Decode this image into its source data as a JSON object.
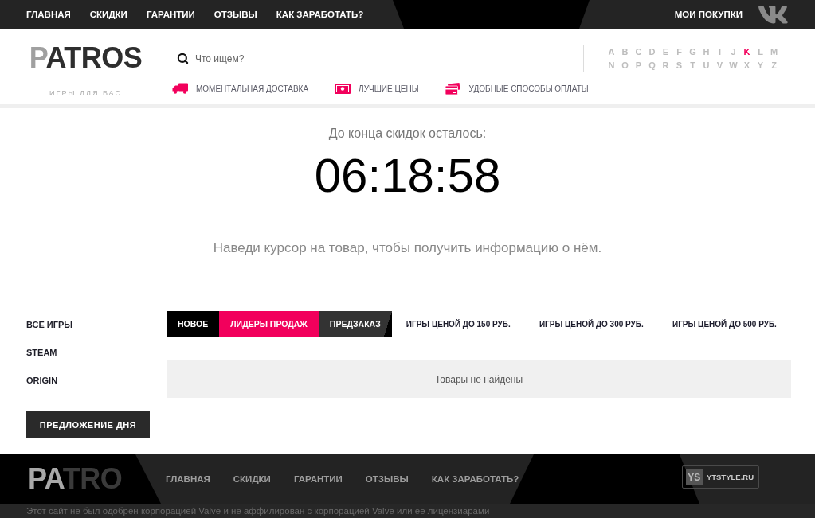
{
  "top_nav": {
    "links": [
      "ГЛАВНАЯ",
      "СКИДКИ",
      "ГАРАНТИИ",
      "ОТЗЫВЫ",
      "КАК ЗАРАБОТАТЬ?"
    ],
    "purchases": "МОИ ПОКУПКИ"
  },
  "header": {
    "logo": {
      "accent": "P",
      "rest": "ATROS"
    },
    "tagline": "ИГРЫ ДЛЯ ВАС",
    "search": {
      "placeholder": "Что ищем?"
    },
    "features": [
      {
        "kind": "delivery",
        "label": "МОМЕНТАЛЬНАЯ ДОСТАВКА"
      },
      {
        "kind": "price",
        "label": "ЛУЧШИЕ ЦЕНЫ"
      },
      {
        "kind": "payment",
        "label": "УДОБНЫЕ СПОСОБЫ ОПЛАТЫ"
      }
    ],
    "alphabet": [
      {
        "letter": "A",
        "selected": false
      },
      {
        "letter": "B",
        "selected": false
      },
      {
        "letter": "C",
        "selected": false
      },
      {
        "letter": "D",
        "selected": false
      },
      {
        "letter": "E",
        "selected": false
      },
      {
        "letter": "F",
        "selected": false
      },
      {
        "letter": "G",
        "selected": false
      },
      {
        "letter": "H",
        "selected": false
      },
      {
        "letter": "I",
        "selected": false
      },
      {
        "letter": "J",
        "selected": false
      },
      {
        "letter": "K",
        "selected": true
      },
      {
        "letter": "L",
        "selected": false
      },
      {
        "letter": "M",
        "selected": false
      },
      {
        "letter": "N",
        "selected": false
      },
      {
        "letter": "O",
        "selected": false
      },
      {
        "letter": "P",
        "selected": false
      },
      {
        "letter": "Q",
        "selected": false
      },
      {
        "letter": "R",
        "selected": false
      },
      {
        "letter": "S",
        "selected": false
      },
      {
        "letter": "T",
        "selected": false
      },
      {
        "letter": "U",
        "selected": false
      },
      {
        "letter": "V",
        "selected": false
      },
      {
        "letter": "W",
        "selected": false
      },
      {
        "letter": "X",
        "selected": false
      },
      {
        "letter": "Y",
        "selected": false
      },
      {
        "letter": "Z",
        "selected": false
      }
    ]
  },
  "countdown": {
    "label": "До конца скидок осталось:",
    "time": "06:18:58"
  },
  "hint": "Наведи курсор на товар, чтобы получить информацию о нём.",
  "sidebar": {
    "items": [
      "ВСЕ ИГРЫ",
      "STEAM",
      "ORIGIN"
    ],
    "deal_button": "ПРЕДЛОЖЕНИЕ ДНЯ"
  },
  "tabs": [
    {
      "label": "НОВОЕ",
      "kind": "solid",
      "selected": false
    },
    {
      "label": "ЛИДЕРЫ ПРОДАЖ",
      "kind": "solid",
      "selected": true
    },
    {
      "label": "ПРЕДЗАКАЗ",
      "kind": "shaded",
      "selected": false
    },
    {
      "label": "ИГРЫ ЦЕНОЙ ДО 150 РУБ.",
      "kind": "text",
      "selected": false
    },
    {
      "label": "ИГРЫ ЦЕНОЙ ДО 300 РУБ.",
      "kind": "text",
      "selected": false
    },
    {
      "label": "ИГРЫ ЦЕНОЙ ДО 500 РУБ.",
      "kind": "text",
      "selected": false
    }
  ],
  "results": {
    "empty_text": "Товары не найдены"
  },
  "footer": {
    "logo": {
      "accent": "PA",
      "rest": "TRO"
    },
    "links": [
      "ГЛАВНАЯ",
      "СКИДКИ",
      "ГАРАНТИИ",
      "ОТЗЫВЫ",
      "КАК ЗАРАБОТАТЬ?"
    ],
    "badge": {
      "mark": "YS",
      "label": "YTSTYLE.RU"
    },
    "disclaimer": "Этот сайт не был одобрен корпорацией Valve и не аффилирован с корпорацией Valve или ее лицензиарами"
  }
}
